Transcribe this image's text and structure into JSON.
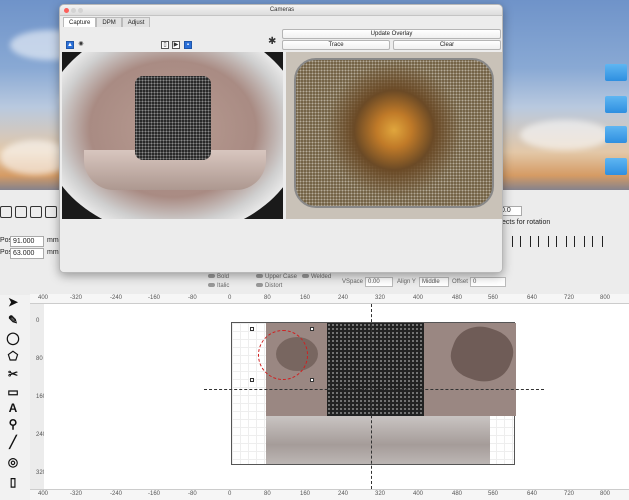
{
  "camera_window": {
    "title": "Cameras",
    "tabs": [
      {
        "label": "Capture",
        "active": true
      },
      {
        "label": "DPM",
        "active": false
      },
      {
        "label": "Adjust",
        "active": false
      }
    ],
    "buttons": {
      "update_overlay": "Update Overlay",
      "trace": "Trace",
      "clear": "Clear"
    }
  },
  "position": {
    "x_label": "Pos",
    "x_value": "91.000",
    "y_label": "Pos",
    "y_value": "63.000",
    "unit": "mm"
  },
  "right_panel": {
    "value": "0.0",
    "text": "ects for rotation"
  },
  "text_options": {
    "bold": "Bold",
    "italic": "Italic",
    "upper_case": "Upper Case",
    "distort": "Distort",
    "welded": "Welded",
    "vspace_label": "VSpace",
    "vspace_value": "0.00",
    "align_y_label": "Align Y",
    "align_y_value": "Middle",
    "offset_label": "Offset",
    "offset_value": "0"
  },
  "ruler_top": [
    "400",
    "-320",
    "-240",
    "-160",
    "-80",
    "0",
    "80",
    "160",
    "240",
    "320",
    "400",
    "480",
    "560",
    "640",
    "720",
    "800"
  ],
  "ruler_left": [
    "0",
    "80",
    "160",
    "240",
    "320"
  ],
  "colors": {
    "accent": "#2a6fd8",
    "red_circle": "#d02020"
  }
}
